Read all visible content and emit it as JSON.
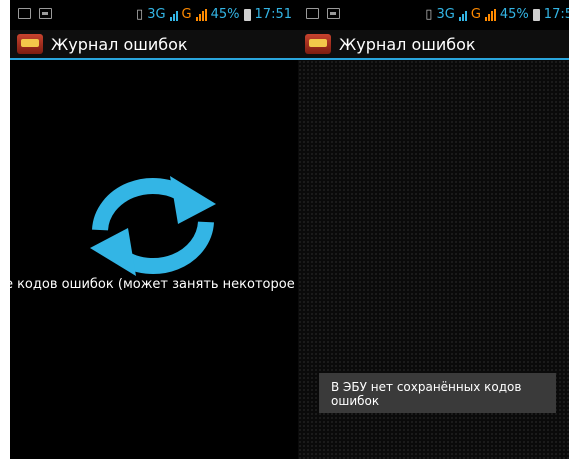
{
  "left_screen": {
    "status": {
      "network": "3G",
      "carrier": "G",
      "battery": "45%",
      "time": "17:51"
    },
    "title": "Журнал ошибок",
    "loading_text": "ние кодов ошибок (может занять некоторое вре"
  },
  "right_screen": {
    "status": {
      "network": "3G",
      "carrier": "G",
      "battery": "45%",
      "time": "17:5"
    },
    "title": "Журнал ошибок",
    "toast": "В ЭБУ нет сохранённых кодов ошибок"
  },
  "colors": {
    "accent": "#33b5e5",
    "carrier": "#ff8a00",
    "toast_bg": "#3a3a3a"
  },
  "icons": [
    "notification-icon",
    "image-icon",
    "vibrate-icon",
    "signal-icon",
    "battery-icon",
    "app-icon",
    "refresh-icon"
  ]
}
